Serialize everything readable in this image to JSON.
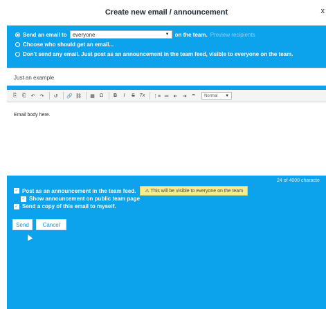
{
  "dialog": {
    "title": "Create new email / announcement",
    "close_label": "x"
  },
  "recipients": {
    "send_to_label": "Send an email to",
    "selected": "everyone",
    "suffix": "on the team.",
    "preview_link": "Preview recipients",
    "choose_label": "Choose who should get an email...",
    "no_email_label": "Don't send any email. Just post as an announcement in the team feed, visible to everyone on the team."
  },
  "subject": {
    "value": "Just an example"
  },
  "toolbar": {
    "format_value": "Normal",
    "buttons": [
      "⎘",
      "⎗",
      "↶",
      "↷",
      "↺",
      "🔗",
      "⛓",
      "▦",
      "Ω",
      "B",
      "I",
      "S",
      "Tx",
      "⋮≡",
      "≔",
      "⇤",
      "⇥",
      "❞"
    ]
  },
  "editor": {
    "body": "Email body here."
  },
  "counter": {
    "text": "24 of 4000 characte"
  },
  "options": {
    "post_announcement": "Post as an announcement in the team feed.",
    "warning": "⚠ This will be visible to everyone on the team",
    "show_public": "Show announcement on public team page",
    "send_copy": "Send a copy of this email to myself."
  },
  "actions": {
    "send": "Send",
    "cancel": "Cancel"
  },
  "colors": {
    "accent": "#0da2ec",
    "warning_bg": "#f6ec8e"
  }
}
